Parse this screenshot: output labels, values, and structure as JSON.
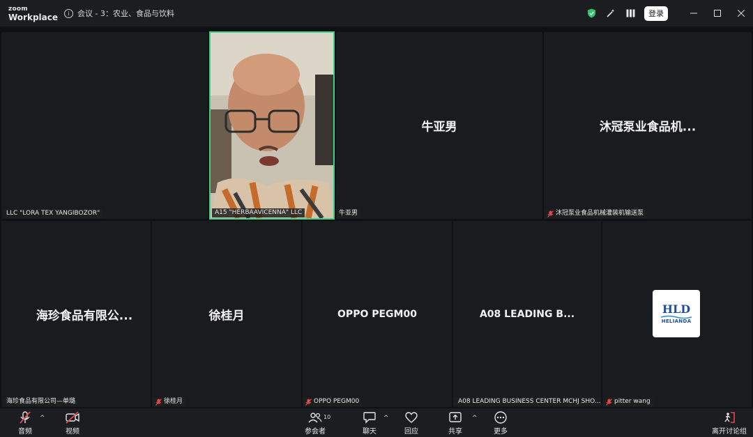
{
  "app": {
    "logo_line1": "zoom",
    "logo_line2": "Workplace",
    "meeting_title": "会议 - 3：农业、食品与饮料",
    "login_label": "登录"
  },
  "tiles": [
    {
      "name": "LLC \"LORA TEX YANGIBOZOR\"",
      "display": "",
      "muted": false
    },
    {
      "name": "A15 \"HERBAAVICENNA\" LLC",
      "display": "",
      "muted": false,
      "active_speaker": true
    },
    {
      "name": "牛亚男",
      "display": "牛亚男",
      "muted": false
    },
    {
      "name": "沐冠泵业食品机械灌装机输送泵",
      "display": "沐冠泵业食品机...",
      "muted": true
    },
    {
      "name": "海珍食品有限公司—单璐",
      "display": "海珍食品有限公...",
      "muted": false
    },
    {
      "name": "徐桂月",
      "display": "徐桂月",
      "muted": true
    },
    {
      "name": "OPPO PEGM00",
      "display": "OPPO PEGM00",
      "muted": true
    },
    {
      "name": "A08 LEADING BUSINESS CENTER MCHJ  SHO...",
      "display": "A08  LEADING  B...",
      "muted": true
    },
    {
      "name": "pitter wang",
      "display": "",
      "muted": true,
      "avatar_text": "HLD",
      "avatar_sub": "HELIANDA"
    }
  ],
  "toolbar": {
    "audio": "音频",
    "video": "视频",
    "participants": "参会者",
    "participants_count": "10",
    "chat": "聊天",
    "react": "回应",
    "share": "共享",
    "more": "更多",
    "leave": "离开讨论组"
  },
  "colors": {
    "active_border": "#3fd08a",
    "muted_red": "#e5484d",
    "shield_green": "#2dc26b"
  }
}
